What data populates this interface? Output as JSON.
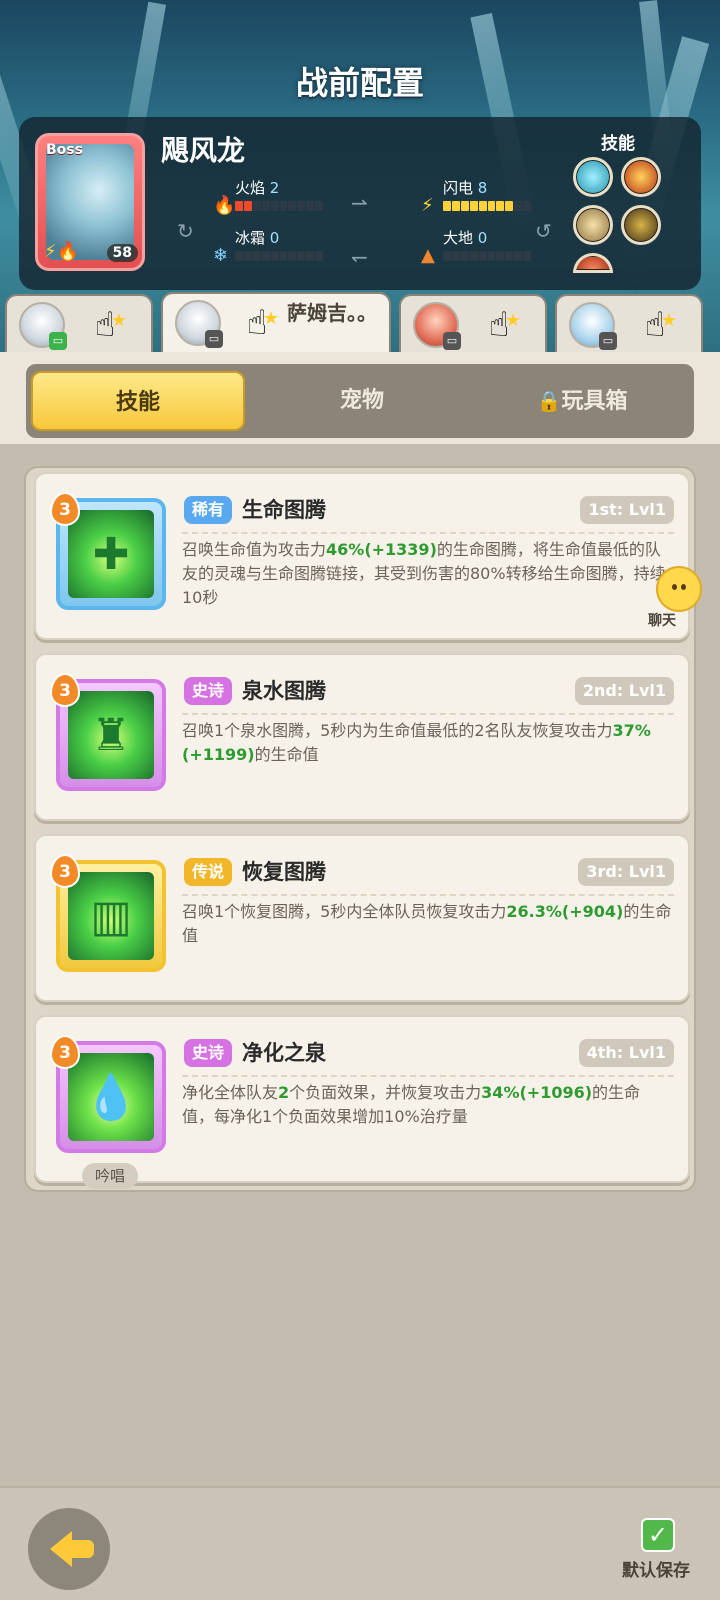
{
  "header": {
    "title": "战前配置"
  },
  "boss": {
    "tag": "Boss",
    "level": "58",
    "name": "飓风龙",
    "stats": {
      "fire": {
        "label": "火焰",
        "value": "2",
        "level": 2
      },
      "lightning": {
        "label": "闪电",
        "value": "8",
        "level": 8
      },
      "frost": {
        "label": "冰霜",
        "value": "0",
        "level": 0
      },
      "earth": {
        "label": "大地",
        "value": "0",
        "level": 0
      }
    },
    "skills_label": "技能"
  },
  "hero_tabs": [
    {
      "name": "",
      "badge": "green"
    },
    {
      "name": "萨姆吉。。",
      "badge": "gray"
    },
    {
      "name": "",
      "badge": "gray"
    },
    {
      "name": "",
      "badge": "gray"
    }
  ],
  "mode_tabs": {
    "skills": "技能",
    "pets": "宠物",
    "toybox": "玩具箱"
  },
  "skills": [
    {
      "level": "3",
      "rarity": "稀有",
      "name": "生命图腾",
      "slot": "1st: Lvl1",
      "desc_parts": [
        "召唤生命值为攻击力",
        "46%(+1339)",
        "的生命图腾，将生命值最低的队友的灵魂与生命图腾链接，其受到伤害的80%转移给生命图腾，持续10秒"
      ]
    },
    {
      "level": "3",
      "rarity": "史诗",
      "name": "泉水图腾",
      "slot": "2nd: Lvl1",
      "desc_parts": [
        "召唤1个泉水图腾，5秒内为生命值最低的2名队友恢复攻击力",
        "37%(+1199)",
        "的生命值"
      ]
    },
    {
      "level": "3",
      "rarity": "传说",
      "name": "恢复图腾",
      "slot": "3rd: Lvl1",
      "desc_parts": [
        "召唤1个恢复图腾，5秒内全体队员恢复攻击力",
        "26.3%(+904)",
        "的生命值"
      ]
    },
    {
      "level": "3",
      "rarity": "史诗",
      "name": "净化之泉",
      "slot": "4th: Lvl1",
      "desc_parts": [
        "净化全体队友",
        "2",
        "个负面效果，并恢复攻击力",
        "34%(+1096)",
        "的生命值，每净化1个负面效果增加10%治疗量"
      ],
      "tag": "吟唱"
    }
  ],
  "chat": {
    "label": "聊天"
  },
  "footer": {
    "save_label": "默认保存"
  },
  "colors": {
    "accent": "#f6c83b",
    "heal_value": "#2e9a2f"
  }
}
